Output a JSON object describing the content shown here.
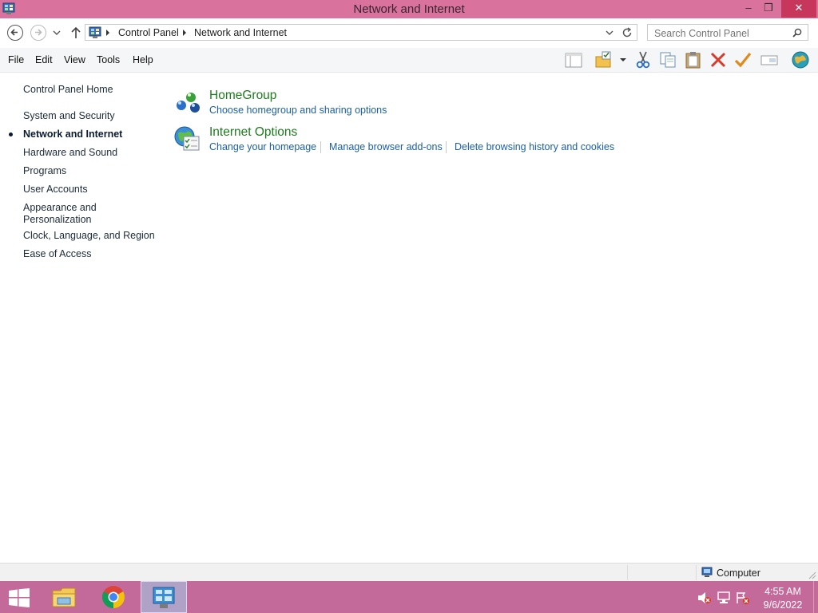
{
  "window": {
    "title": "Network and Internet",
    "controls": {
      "minimize": "–",
      "restore": "❐",
      "close": "✕"
    }
  },
  "address": {
    "breadcrumb": [
      "Control Panel",
      "Network and Internet"
    ],
    "search_placeholder": "Search Control Panel"
  },
  "menu": {
    "items": [
      "File",
      "Edit",
      "View",
      "Tools",
      "Help"
    ]
  },
  "toolbar": {
    "icons": [
      "layout-icon",
      "folder-properties-icon",
      "dropdown-arrow-icon",
      "cut-icon",
      "copy-icon",
      "paste-icon",
      "delete-icon",
      "checkmark-icon",
      "rename-icon",
      "globe-icon"
    ]
  },
  "sidebar": {
    "home": "Control Panel Home",
    "items": [
      {
        "label": "System and Security",
        "active": false
      },
      {
        "label": "Network and Internet",
        "active": true
      },
      {
        "label": "Hardware and Sound",
        "active": false
      },
      {
        "label": "Programs",
        "active": false
      },
      {
        "label": "User Accounts",
        "active": false
      },
      {
        "label": "Appearance and Personalization",
        "active": false
      },
      {
        "label": "Clock, Language, and Region",
        "active": false
      },
      {
        "label": "Ease of Access",
        "active": false
      }
    ]
  },
  "categories": [
    {
      "title": "HomeGroup",
      "icon": "homegroup-icon",
      "tasks": [
        "Choose homegroup and sharing options"
      ]
    },
    {
      "title": "Internet Options",
      "icon": "internet-options-icon",
      "tasks": [
        "Change your homepage",
        "Manage browser add-ons",
        "Delete browsing history and cookies"
      ]
    }
  ],
  "statusbar": {
    "location": "Computer"
  },
  "taskbar": {
    "apps": [
      "start-icon",
      "file-explorer-icon",
      "chrome-icon",
      "control-panel-icon"
    ],
    "tray": [
      "speaker-muted-icon",
      "network-icon",
      "action-center-icon"
    ],
    "time": "4:55 AM",
    "date": "9/6/2022"
  },
  "colors": {
    "titlebar": "#d9739d",
    "taskbar": "#c46a9a",
    "link": "#1a5fa6",
    "category": "#1e7a1e"
  }
}
